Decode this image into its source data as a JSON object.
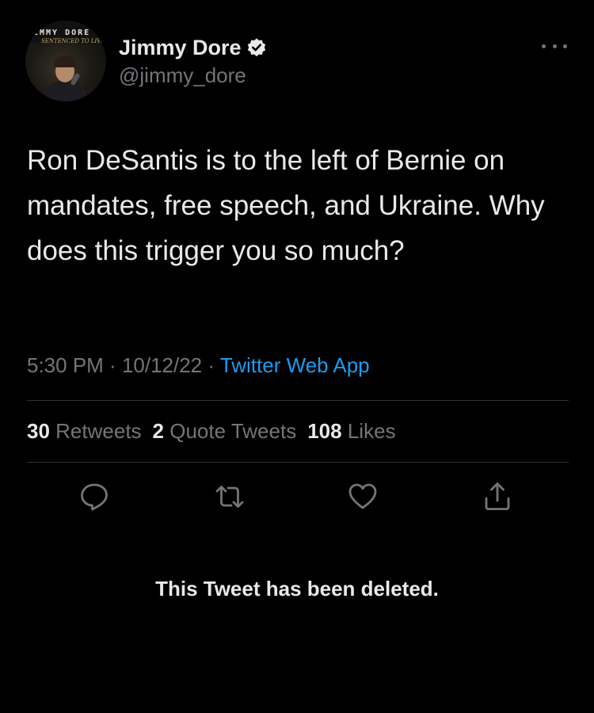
{
  "author": {
    "display_name": "Jimmy Dore",
    "handle": "@jimmy_dore",
    "verified": true,
    "avatar": {
      "poster_title": "IMMY DORE",
      "poster_subtitle": "SENTENCED TO LIVE"
    }
  },
  "tweet": {
    "text": "Ron DeSantis is to the left of Bernie on mandates, free speech, and Ukraine. Why does this trigger you so much?",
    "time": "5:30 PM",
    "separator": " · ",
    "date": "10/12/22",
    "source": "Twitter Web App"
  },
  "stats": {
    "retweets_count": "30",
    "retweets_label": "Retweets",
    "quotes_count": "2",
    "quotes_label": "Quote Tweets",
    "likes_count": "108",
    "likes_label": "Likes"
  },
  "actions": [
    {
      "name": "reply",
      "icon": "reply-icon"
    },
    {
      "name": "retweet",
      "icon": "retweet-icon"
    },
    {
      "name": "like",
      "icon": "heart-icon"
    },
    {
      "name": "share",
      "icon": "share-icon"
    }
  ],
  "notice": "This Tweet has been deleted.",
  "colors": {
    "background": "#000000",
    "text_primary": "#e7e9ea",
    "text_secondary": "#71767b",
    "link": "#1d9bf0",
    "divider": "#2f3336"
  }
}
